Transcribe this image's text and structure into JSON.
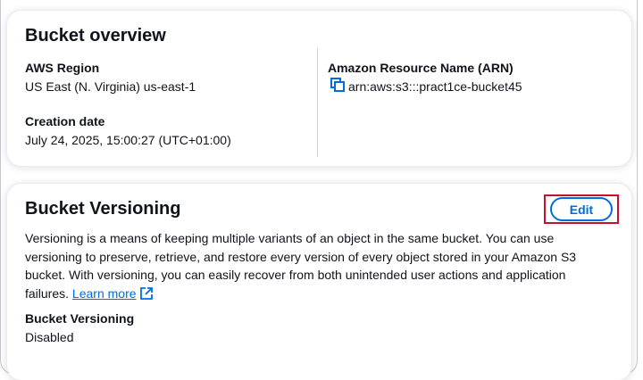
{
  "overview": {
    "title": "Bucket overview",
    "region_label": "AWS Region",
    "region_value": "US East (N. Virginia) us-east-1",
    "creation_label": "Creation date",
    "creation_value": "July 24, 2025, 15:00:27 (UTC+01:00)",
    "arn_label": "Amazon Resource Name (ARN)",
    "arn_value": "arn:aws:s3:::pract1ce-bucket45"
  },
  "versioning": {
    "title": "Bucket Versioning",
    "edit_label": "Edit",
    "description": "Versioning is a means of keeping multiple variants of an object in the same bucket. You can use versioning to preserve, retrieve, and restore every version of every object stored in your Amazon S3 bucket. With versioning, you can easily recover from both unintended user actions and application failures.",
    "learn_more": "Learn more",
    "status_label": "Bucket Versioning",
    "status_value": "Disabled"
  },
  "colors": {
    "link": "#006ce0",
    "highlight_box": "#c8102e",
    "text": "#0f141a"
  },
  "icons": {
    "copy": "copy-icon",
    "external": "external-link-icon"
  }
}
